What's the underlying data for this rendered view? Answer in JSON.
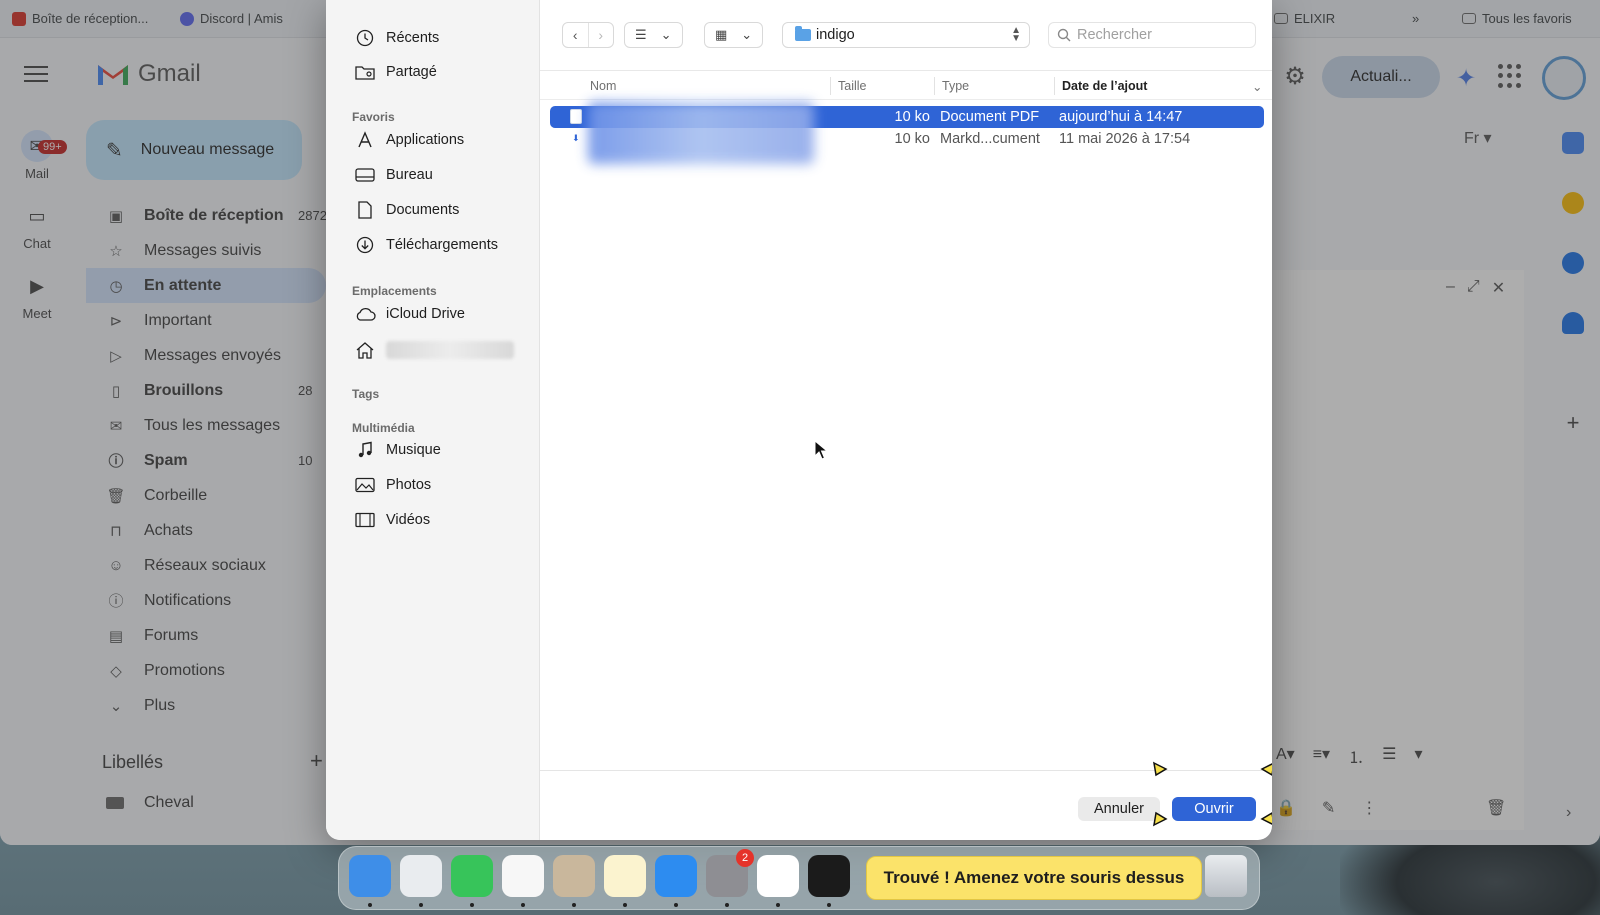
{
  "browser": {
    "bookmarks": [
      {
        "label": "Boîte de réception..."
      },
      {
        "label": "Discord | Amis"
      },
      {
        "label": "ELIXIR"
      },
      {
        "label": "Tous les favoris"
      }
    ],
    "more_label": "»"
  },
  "gmail": {
    "app_name": "Gmail",
    "update_button": "Actuali...",
    "rail": [
      {
        "label": "Mail",
        "badge": "99+"
      },
      {
        "label": "Chat"
      },
      {
        "label": "Meet"
      }
    ],
    "compose_label": "Nouveau message",
    "nav": [
      {
        "label": "Boîte de réception",
        "count": "2872",
        "bold": true
      },
      {
        "label": "Messages suivis",
        "count": ""
      },
      {
        "label": "En attente",
        "count": "",
        "bold": true,
        "active": true
      },
      {
        "label": "Important",
        "count": ""
      },
      {
        "label": "Messages envoyés",
        "count": ""
      },
      {
        "label": "Brouillons",
        "count": "28",
        "bold": true
      },
      {
        "label": "Tous les messages",
        "count": ""
      },
      {
        "label": "Spam",
        "count": "10",
        "bold": true
      },
      {
        "label": "Corbeille",
        "count": ""
      },
      {
        "label": "Achats",
        "count": ""
      },
      {
        "label": "Réseaux sociaux",
        "count": ""
      },
      {
        "label": "Notifications",
        "count": ""
      },
      {
        "label": "Forums",
        "count": ""
      },
      {
        "label": "Promotions",
        "count": ""
      },
      {
        "label": "Plus",
        "count": ""
      }
    ],
    "labels_heading": "Libellés",
    "labels": [
      {
        "label": "Cheval"
      }
    ],
    "lang_button": "Fr"
  },
  "dialog": {
    "sidebar": {
      "top": [
        {
          "label": "Récents",
          "icon": "clock-icon"
        },
        {
          "label": "Partagé",
          "icon": "shared-folder-icon"
        }
      ],
      "favorites_heading": "Favoris",
      "favorites": [
        {
          "label": "Applications",
          "icon": "applications-icon"
        },
        {
          "label": "Bureau",
          "icon": "desktop-icon"
        },
        {
          "label": "Documents",
          "icon": "document-icon"
        },
        {
          "label": "Téléchargements",
          "icon": "download-icon"
        }
      ],
      "locations_heading": "Emplacements",
      "locations": [
        {
          "label": "iCloud Drive",
          "icon": "cloud-icon"
        },
        {
          "label": "",
          "icon": "home-icon"
        }
      ],
      "tags_heading": "Tags",
      "media_heading": "Multimédia",
      "media": [
        {
          "label": "Musique",
          "icon": "music-icon"
        },
        {
          "label": "Photos",
          "icon": "photos-icon"
        },
        {
          "label": "Vidéos",
          "icon": "video-icon"
        }
      ]
    },
    "path": "indigo",
    "search_placeholder": "Rechercher",
    "columns": {
      "name": "Nom",
      "size": "Taille",
      "type": "Type",
      "date": "Date de l’ajout"
    },
    "files": [
      {
        "size": "10 ko",
        "type": "Document PDF",
        "date": "aujourd’hui à 14:47",
        "selected": true
      },
      {
        "size": "10 ko",
        "type": "Markd...cument",
        "date": "11 mai 2026 à 17:54",
        "selected": false
      }
    ],
    "cancel_label": "Annuler",
    "open_label": "Ouvrir"
  },
  "dock": {
    "apps": [
      {
        "name": "Finder",
        "color": "#3e8ee8"
      },
      {
        "name": "Launchpad",
        "color": "#e9ecef"
      },
      {
        "name": "Messages",
        "color": "#37c45a"
      },
      {
        "name": "Photos",
        "color": "#f7f7f7"
      },
      {
        "name": "Contacts",
        "color": "#c9b79c"
      },
      {
        "name": "Notes",
        "color": "#fbf3cf"
      },
      {
        "name": "App Store",
        "color": "#2d8cf0"
      },
      {
        "name": "Réglages Système",
        "color": "#8e8e93",
        "badge": "2"
      },
      {
        "name": "Chrome",
        "color": "#ffffff"
      },
      {
        "name": "Terminal",
        "color": "#1b1b1b"
      }
    ],
    "toast": "Trouvé ! Amenez votre souris dessus"
  }
}
